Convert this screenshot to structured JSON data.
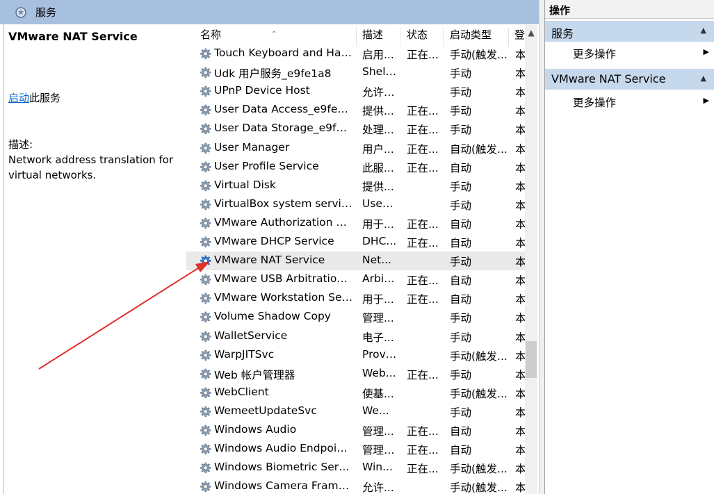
{
  "header": {
    "title": "服务",
    "icon": "search-icon"
  },
  "description": {
    "service_title": "VMware NAT Service",
    "action_link": "启动",
    "action_suffix": "此服务",
    "label": "描述:",
    "text": "Network address translation for virtual networks."
  },
  "table": {
    "columns": [
      "名称",
      "描述",
      "状态",
      "启动类型",
      "登"
    ],
    "rows": [
      {
        "name": "Touch Keyboard and Hand...",
        "desc": "启用...",
        "status": "正在...",
        "startup": "手动(触发...",
        "logon": "本"
      },
      {
        "name": "Udk 用户服务_e9fe1a8",
        "desc": "Shell...",
        "status": "",
        "startup": "手动",
        "logon": "本"
      },
      {
        "name": "UPnP Device Host",
        "desc": "允许 ...",
        "status": "",
        "startup": "手动",
        "logon": "本"
      },
      {
        "name": "User Data Access_e9fe1a8",
        "desc": "提供...",
        "status": "正在...",
        "startup": "手动",
        "logon": "本"
      },
      {
        "name": "User Data Storage_e9fe1a8",
        "desc": "处理...",
        "status": "正在...",
        "startup": "手动",
        "logon": "本"
      },
      {
        "name": "User Manager",
        "desc": "用户...",
        "status": "正在...",
        "startup": "自动(触发...",
        "logon": "本"
      },
      {
        "name": "User Profile Service",
        "desc": "此服...",
        "status": "正在...",
        "startup": "自动",
        "logon": "本"
      },
      {
        "name": "Virtual Disk",
        "desc": "提供...",
        "status": "",
        "startup": "手动",
        "logon": "本"
      },
      {
        "name": "VirtualBox system service",
        "desc": "Used...",
        "status": "",
        "startup": "手动",
        "logon": "本"
      },
      {
        "name": "VMware Authorization Ser...",
        "desc": "用于...",
        "status": "正在...",
        "startup": "自动",
        "logon": "本"
      },
      {
        "name": "VMware DHCP Service",
        "desc": "DHC...",
        "status": "正在...",
        "startup": "自动",
        "logon": "本"
      },
      {
        "name": "VMware NAT Service",
        "desc": "Net...",
        "status": "",
        "startup": "手动",
        "logon": "本"
      },
      {
        "name": "VMware USB Arbitration S...",
        "desc": "Arbit...",
        "status": "正在...",
        "startup": "自动",
        "logon": "本"
      },
      {
        "name": "VMware Workstation Server",
        "desc": "用于...",
        "status": "正在...",
        "startup": "自动",
        "logon": "本"
      },
      {
        "name": "Volume Shadow Copy",
        "desc": "管理...",
        "status": "",
        "startup": "手动",
        "logon": "本"
      },
      {
        "name": "WalletService",
        "desc": "电子...",
        "status": "",
        "startup": "手动",
        "logon": "本"
      },
      {
        "name": "WarpJITSvc",
        "desc": "Provi...",
        "status": "",
        "startup": "手动(触发...",
        "logon": "本"
      },
      {
        "name": "Web 帐户管理器",
        "desc": "Web...",
        "status": "正在...",
        "startup": "手动",
        "logon": "本"
      },
      {
        "name": "WebClient",
        "desc": "使基...",
        "status": "",
        "startup": "手动(触发...",
        "logon": "本"
      },
      {
        "name": "WemeetUpdateSvc",
        "desc": "We...",
        "status": "",
        "startup": "手动",
        "logon": "本"
      },
      {
        "name": "Windows Audio",
        "desc": "管理...",
        "status": "正在...",
        "startup": "自动",
        "logon": "本"
      },
      {
        "name": "Windows Audio Endpoint B...",
        "desc": "管理 ...",
        "status": "正在...",
        "startup": "自动",
        "logon": "本"
      },
      {
        "name": "Windows Biometric Service",
        "desc": "Win...",
        "status": "正在...",
        "startup": "手动(触发...",
        "logon": "本"
      },
      {
        "name": "Windows Camera Frame S...",
        "desc": "允许...",
        "status": "",
        "startup": "手动(触发...",
        "logon": "本"
      }
    ],
    "selected_row": "VMware NAT Service"
  },
  "actions": {
    "title": "操作",
    "sections": [
      {
        "label": "服务",
        "item": "更多操作"
      },
      {
        "label": "VMware NAT Service",
        "item": "更多操作"
      }
    ]
  },
  "colors": {
    "header_bg": "#a8c0e0",
    "section_bg": "#c6d8ec",
    "link": "#0066cc",
    "annotation_arrow": "#e0302a"
  }
}
